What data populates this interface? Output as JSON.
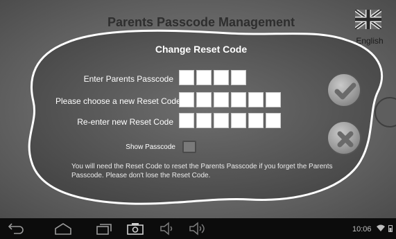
{
  "background": {
    "title": "Parents Passcode Management",
    "language_label": "English",
    "language_flag_icon": "uk-flag-icon"
  },
  "dialog": {
    "title": "Change Reset Code",
    "enter_passcode_label": "Enter Parents Passcode",
    "new_reset_label": "Please choose a new Reset Code",
    "reenter_reset_label": "Re-enter new Reset Code",
    "show_passcode_label": "Show Passcode",
    "show_passcode_checked": false,
    "info_text": "You will need the Reset Code to reset the Parents Passcode if you forget the Parents Passcode. Please don't lose the Reset Code.",
    "confirm_icon": "checkmark-icon",
    "cancel_icon": "close-icon"
  },
  "navbar": {
    "icons": [
      "back-icon",
      "home-icon",
      "recent-apps-icon",
      "screenshot-icon",
      "volume-down-icon",
      "volume-up-icon"
    ],
    "time": "10:06"
  }
}
